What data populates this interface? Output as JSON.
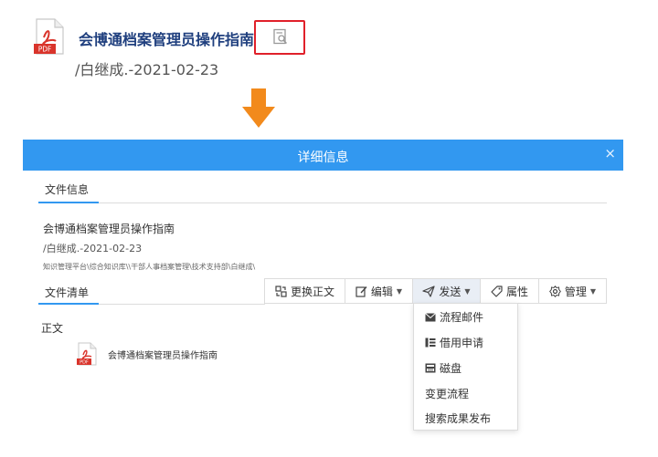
{
  "callout": {
    "file_title": "会博通档案管理员操作指南",
    "file_meta": "/白继成.-2021-02-23",
    "pdf_badge": "PDF"
  },
  "dialog": {
    "title": "详细信息",
    "close": "×",
    "tabs": {
      "file_info": "文件信息",
      "file_list": "文件清单"
    },
    "doc": {
      "title": "会博通档案管理员操作指南",
      "meta": "/白继成.-2021-02-23",
      "path": "知识管理平台\\综合知识库\\\\干部人事档案管理\\技术支持部\\白继成\\"
    },
    "toolbar": {
      "replace": "更换正文",
      "edit": "编辑",
      "send": "发送",
      "properties": "属性",
      "manage": "管理"
    },
    "send_menu": {
      "items": [
        "流程邮件",
        "借用申请",
        "磁盘",
        "变更流程",
        "搜索成果发布"
      ]
    },
    "section_main": "正文",
    "file_item": {
      "name": "会博通档案管理员操作指南",
      "badge": "PDF"
    }
  },
  "colors": {
    "accent": "#3298f0",
    "highlight": "#e0202a",
    "arrow": "#f28a1c",
    "pdf_red": "#d9342b"
  }
}
